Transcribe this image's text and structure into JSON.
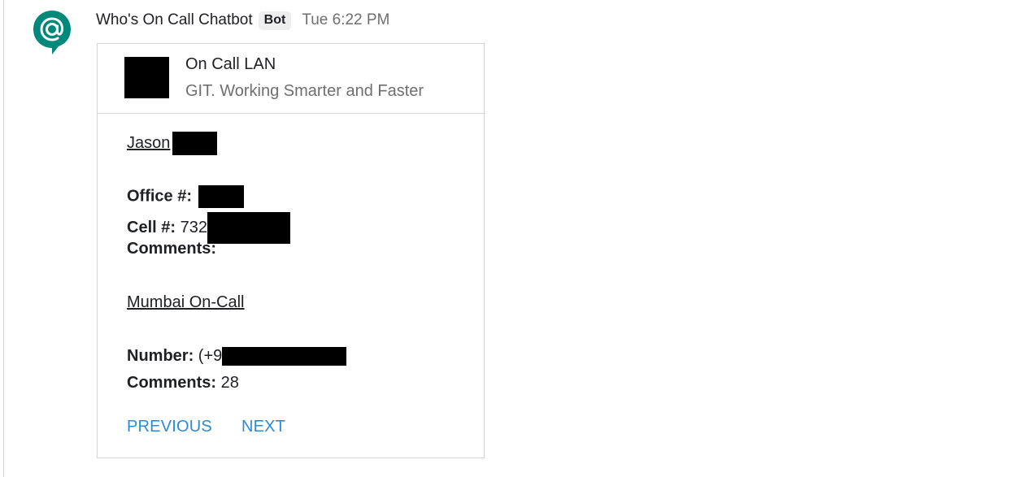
{
  "message": {
    "sender": "Who's On Call Chatbot",
    "badge": "Bot",
    "timestamp": "Tue 6:22 PM",
    "avatar_icon": "at-sign-chat-icon",
    "avatar_color": "#00897b"
  },
  "card": {
    "header": {
      "title": "On Call LAN",
      "subtitle": "GIT. Working Smarter and Faster"
    },
    "primary": {
      "name": "Jason",
      "office_label": "Office #:",
      "cell_label": "Cell #:",
      "cell_value": "732",
      "comments_label": "Comments:"
    },
    "secondary": {
      "name": "Mumbai On-Call",
      "number_label": "Number:",
      "number_value": "(+9",
      "comments_label": "Comments:",
      "comments_value": "28"
    },
    "actions": {
      "previous": "PREVIOUS",
      "next": "NEXT"
    },
    "link_color": "#2c8ad8"
  }
}
